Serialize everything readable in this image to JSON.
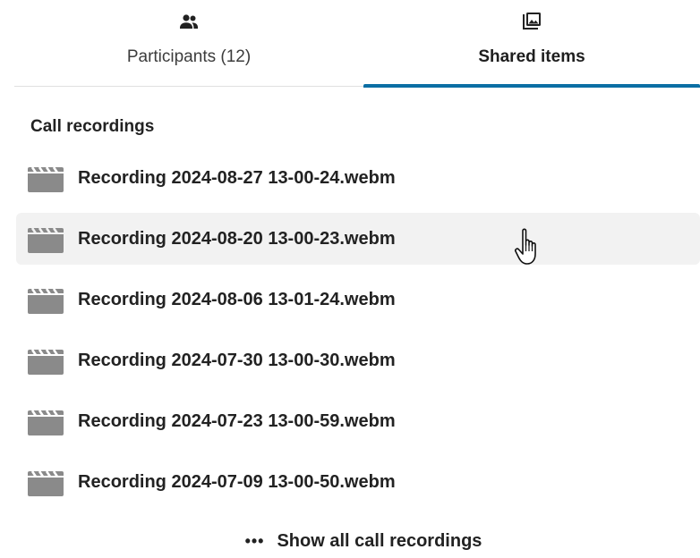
{
  "tabs": [
    {
      "label": "Participants (12)",
      "icon": "people-icon",
      "active": false
    },
    {
      "label": "Shared items",
      "icon": "photo-library-icon",
      "active": true
    }
  ],
  "section": {
    "title": "Call recordings"
  },
  "recordings": [
    {
      "name": "Recording 2024-08-27 13-00-24.webm",
      "icon": "video-file-icon"
    },
    {
      "name": "Recording 2024-08-20 13-00-23.webm",
      "icon": "video-file-icon",
      "hovered": true
    },
    {
      "name": "Recording 2024-08-06 13-01-24.webm",
      "icon": "video-file-icon"
    },
    {
      "name": "Recording 2024-07-30 13-00-30.webm",
      "icon": "video-file-icon"
    },
    {
      "name": "Recording 2024-07-23 13-00-59.webm",
      "icon": "video-file-icon"
    },
    {
      "name": "Recording 2024-07-09 13-00-50.webm",
      "icon": "video-file-icon"
    }
  ],
  "show_all": {
    "icon": "more-horizontal-icon",
    "label": "Show all call recordings"
  },
  "colors": {
    "accent": "#0b6fa4",
    "file_icon": "#8a8a8a",
    "hover_background": "#f2f2f2"
  }
}
